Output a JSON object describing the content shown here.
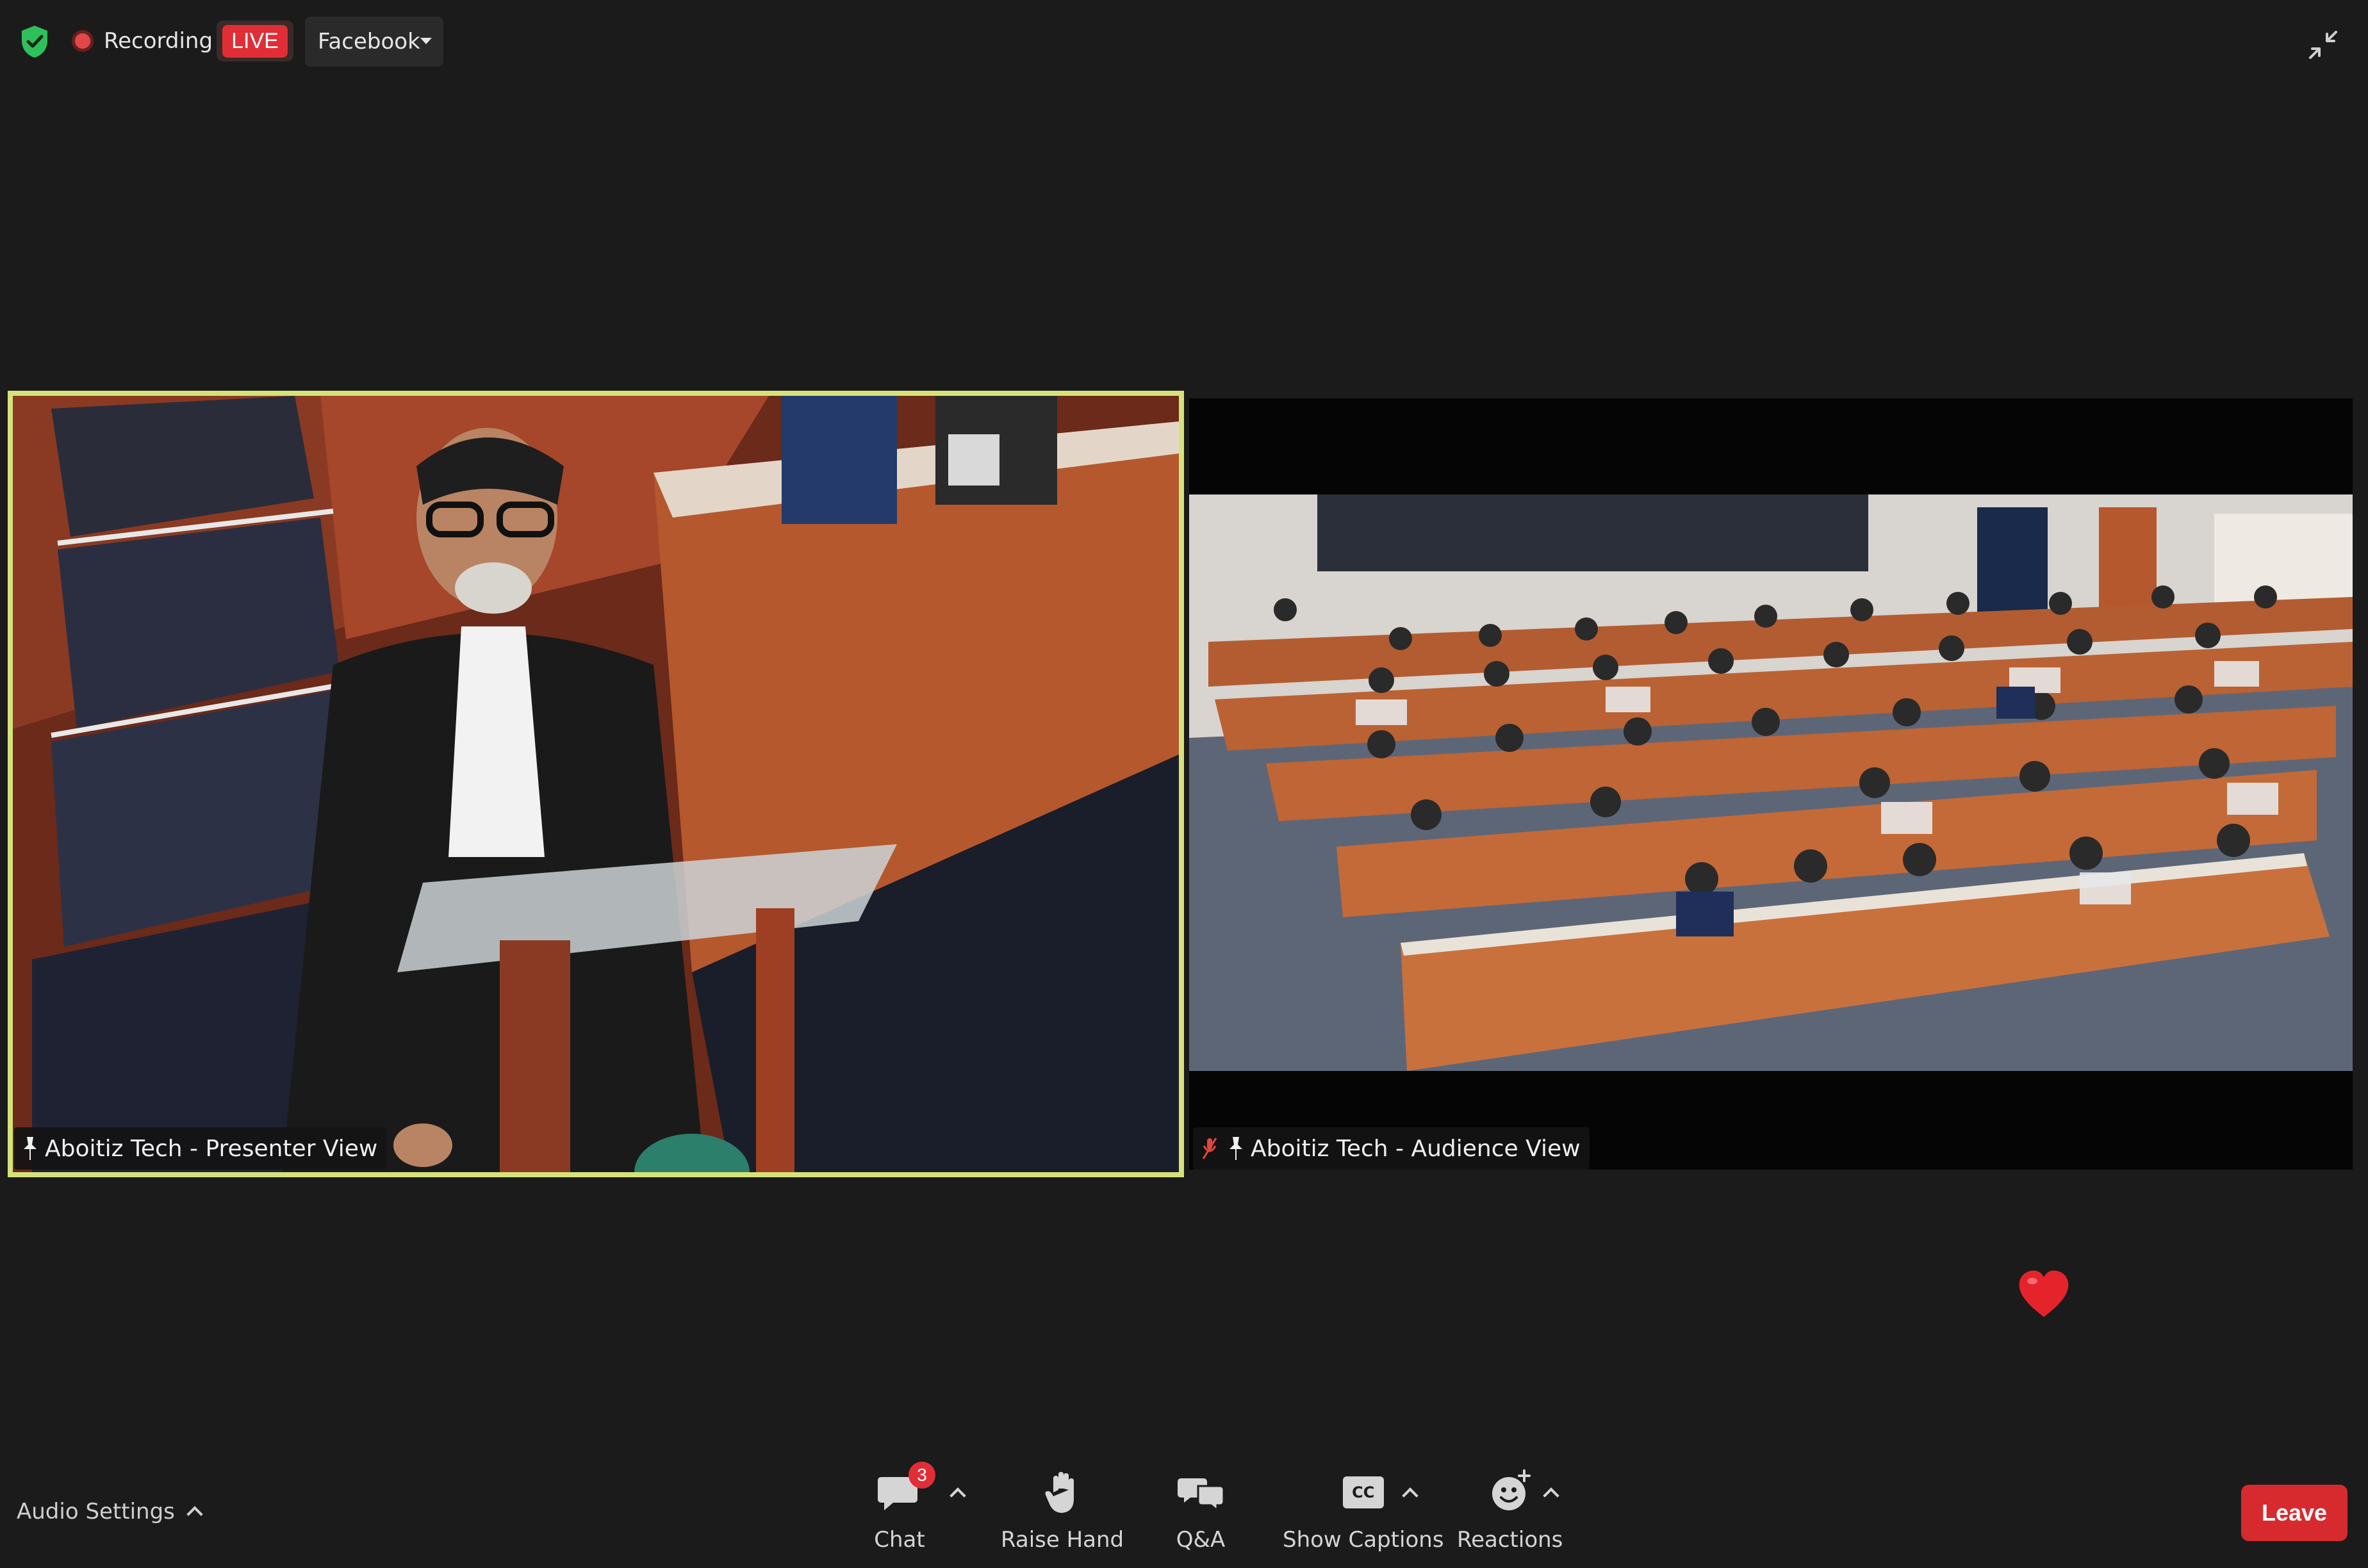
{
  "top_bar": {
    "recording_label": "Recording",
    "live_label": "LIVE",
    "stream_destination": "Facebook"
  },
  "videos": [
    {
      "name": "Aboitiz Tech - Presenter View",
      "active_speaker": true
    },
    {
      "name": "Aboitiz Tech - Audience View",
      "muted": true
    }
  ],
  "toolbar": {
    "audio_settings_label": "Audio Settings",
    "chat_label": "Chat",
    "chat_unread": "3",
    "raise_hand_label": "Raise Hand",
    "qa_label": "Q&A",
    "captions_label": "Show Captions",
    "captions_icon_text": "CC",
    "reactions_label": "Reactions",
    "leave_label": "Leave"
  },
  "colors": {
    "background": "#1b1b1b",
    "active_speaker_border": "#d5e27a",
    "live_red": "#e12e36",
    "leave_red": "#d72a2f",
    "shield_green": "#2fbf5b"
  },
  "icons": [
    "shield-check-icon",
    "recording-dot-icon",
    "exit-fullscreen-icon",
    "pin-icon",
    "mic-muted-icon",
    "chat-icon",
    "raise-hand-icon",
    "qa-icon",
    "captions-icon",
    "reactions-icon",
    "heart-reaction-icon"
  ]
}
